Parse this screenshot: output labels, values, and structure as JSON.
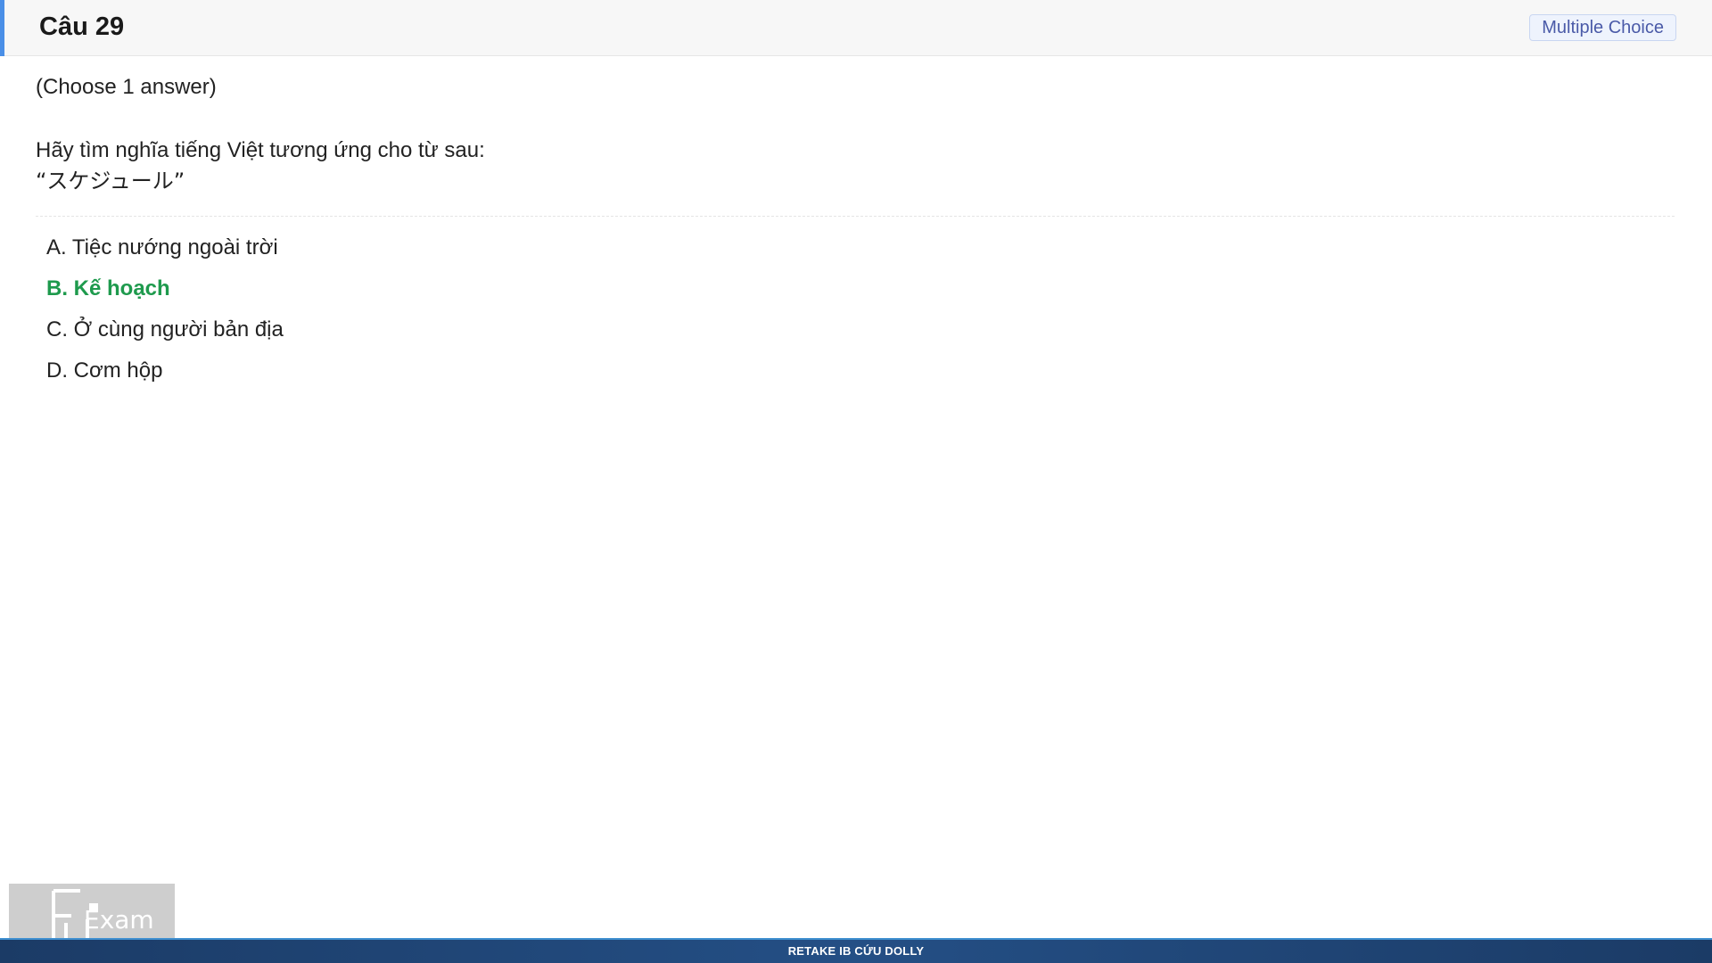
{
  "header": {
    "title": "Câu 29",
    "badge": "Multiple Choice",
    "accent_color": "#4a8fe7"
  },
  "question": {
    "instruction": "(Choose 1 answer)",
    "prompt": "Hãy tìm nghĩa tiếng Việt tương ứng cho từ sau:",
    "word": "“スケジュール”"
  },
  "options": [
    {
      "label": "A. Tiệc nướng ngoài trời",
      "correct": false
    },
    {
      "label": "B. Kế hoạch",
      "correct": true
    },
    {
      "label": "C. Ở cùng người bản địa",
      "correct": false
    },
    {
      "label": "D. Cơm hộp",
      "correct": false
    }
  ],
  "colors": {
    "correct_answer": "#1e9a4d",
    "badge_text": "#4a5aa8",
    "footer_bar": "#244f85"
  },
  "logo": {
    "text": "Exam",
    "icon": "fu-logo-icon"
  },
  "footer": {
    "text": "RETAKE IB CỨU DOLLY"
  }
}
